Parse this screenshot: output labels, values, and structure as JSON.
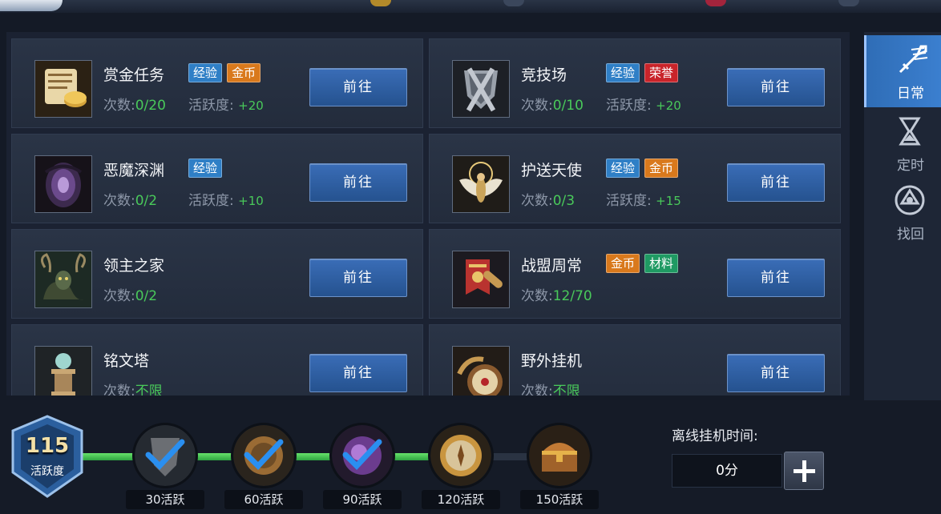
{
  "tasks": [
    {
      "name": "赏金任务",
      "tags": [
        {
          "text": "经验",
          "color": "blue"
        },
        {
          "text": "金币",
          "color": "orange"
        }
      ],
      "count_label": "次数:",
      "count_value": "0/20",
      "activity_label": "活跃度:",
      "activity_value": "+20",
      "button": "前往",
      "icon": "bounty-scroll-icon"
    },
    {
      "name": "竞技场",
      "tags": [
        {
          "text": "经验",
          "color": "blue"
        },
        {
          "text": "荣誉",
          "color": "red"
        }
      ],
      "count_label": "次数:",
      "count_value": "0/10",
      "activity_label": "活跃度:",
      "activity_value": "+20",
      "button": "前往",
      "icon": "armor-shield-icon"
    },
    {
      "name": "恶魔深渊",
      "tags": [
        {
          "text": "经验",
          "color": "blue"
        }
      ],
      "count_label": "次数:",
      "count_value": "0/2",
      "activity_label": "活跃度:",
      "activity_value": "+10",
      "button": "前往",
      "icon": "demon-abyss-icon"
    },
    {
      "name": "护送天使",
      "tags": [
        {
          "text": "经验",
          "color": "blue"
        },
        {
          "text": "金币",
          "color": "orange"
        }
      ],
      "count_label": "次数:",
      "count_value": "0/3",
      "activity_label": "活跃度:",
      "activity_value": "+15",
      "button": "前往",
      "icon": "angel-icon"
    },
    {
      "name": "领主之家",
      "tags": [],
      "count_label": "次数:",
      "count_value": "0/2",
      "activity_label": "",
      "activity_value": "",
      "button": "前往",
      "icon": "lord-home-icon"
    },
    {
      "name": "战盟周常",
      "tags": [
        {
          "text": "金币",
          "color": "orange"
        },
        {
          "text": "材料",
          "color": "green"
        }
      ],
      "count_label": "次数:",
      "count_value": "12/70",
      "activity_label": "",
      "activity_value": "",
      "button": "前往",
      "icon": "guild-banner-icon"
    },
    {
      "name": "铭文塔",
      "tags": [],
      "count_label": "次数:",
      "count_value": "不限",
      "activity_label": "",
      "activity_value": "",
      "button": "前往",
      "icon": "rune-tower-icon"
    },
    {
      "name": "野外挂机",
      "tags": [],
      "count_label": "次数:",
      "count_value": "不限",
      "activity_label": "",
      "activity_value": "",
      "button": "前往",
      "icon": "compass-icon"
    }
  ],
  "sidebar": {
    "tabs": [
      {
        "label": "日常",
        "icon": "sword-icon",
        "active": true
      },
      {
        "label": "定时",
        "icon": "hourglass-icon",
        "active": false
      },
      {
        "label": "找回",
        "icon": "retrieve-icon",
        "active": false
      }
    ]
  },
  "activity": {
    "value": "115",
    "label": "活跃度",
    "progress_fraction": 0.71,
    "milestones": [
      {
        "label": "30活跃",
        "claimed": true,
        "icon": "shield-reward-icon"
      },
      {
        "label": "60活跃",
        "claimed": true,
        "icon": "bronze-compass-reward-icon"
      },
      {
        "label": "90活跃",
        "claimed": true,
        "icon": "purple-orb-reward-icon"
      },
      {
        "label": "120活跃",
        "claimed": false,
        "icon": "compass-reward-icon"
      },
      {
        "label": "150活跃",
        "claimed": false,
        "icon": "treasure-chest-reward-icon"
      }
    ]
  },
  "offline": {
    "label": "离线挂机时间:",
    "value": "0分"
  },
  "colors": {
    "accent_blue": "#2f7fc6",
    "value_green": "#49c95a",
    "tag_orange": "#d9791c",
    "tag_red": "#c9242a",
    "tag_green": "#1f9a63"
  }
}
